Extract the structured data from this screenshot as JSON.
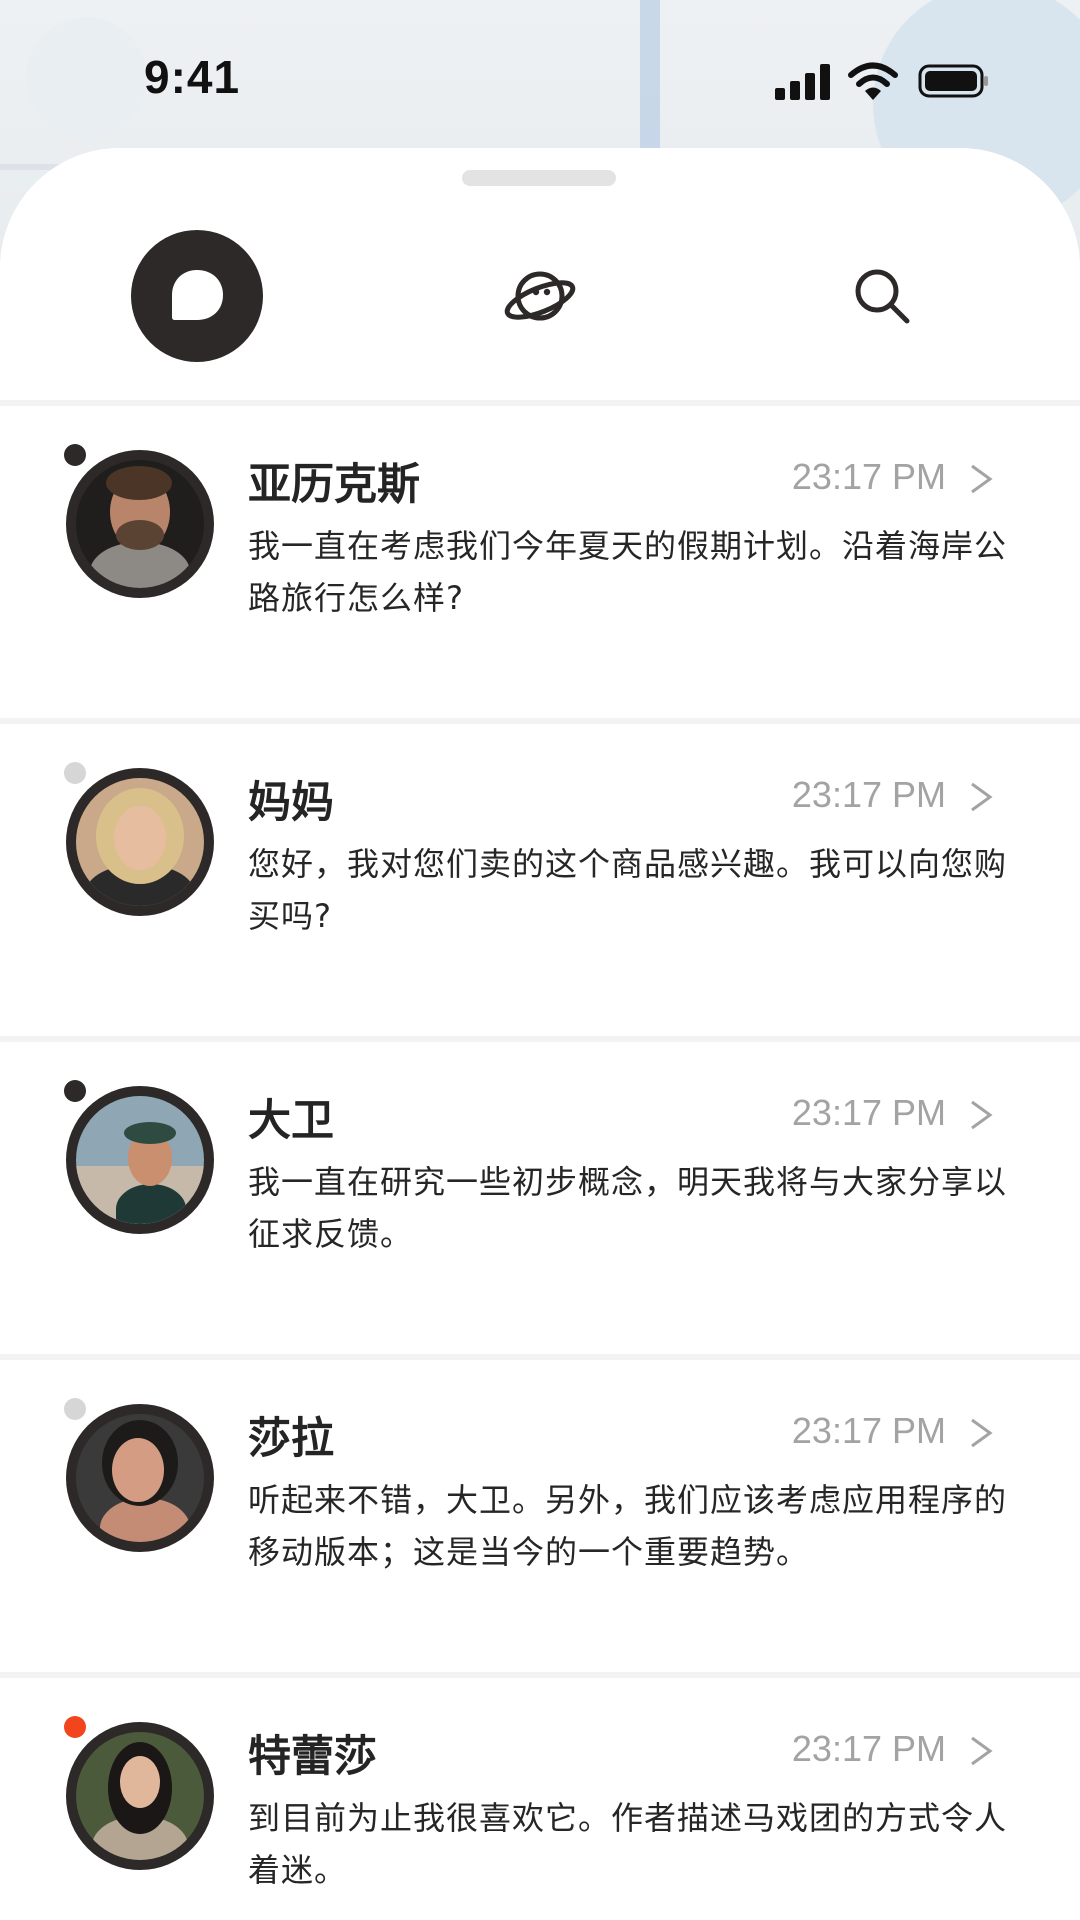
{
  "status_bar": {
    "time": "9:41"
  },
  "theme": {
    "dark": "#2c2928",
    "online_dot": "#2c2928",
    "offline_dot": "#d6d6d6",
    "alert_dot": "#f2451e",
    "time_color": "#a3a3a3"
  },
  "tabs": [
    {
      "name": "chats",
      "icon": "chat-bubble-icon",
      "active": true
    },
    {
      "name": "explore",
      "icon": "planet-icon",
      "active": false
    },
    {
      "name": "search",
      "icon": "search-icon",
      "active": false
    }
  ],
  "chats": [
    {
      "name": "亚历克斯",
      "time": "23:17 PM",
      "preview": "我一直在考虑我们今年夏天的假期计划。沿着海岸公路旅行怎么样?",
      "status": "online"
    },
    {
      "name": "妈妈",
      "time": "23:17 PM",
      "preview": "您好，我对您们卖的这个商品感兴趣。我可以向您购买吗?",
      "status": "offline"
    },
    {
      "name": "大卫",
      "time": "23:17 PM",
      "preview": "我一直在研究一些初步概念，明天我将与大家分享以征求反馈。",
      "status": "online"
    },
    {
      "name": "莎拉",
      "time": "23:17 PM",
      "preview": "听起来不错，大卫。另外，我们应该考虑应用程序的移动版本；这是当今的一个重要趋势。",
      "status": "offline"
    },
    {
      "name": "特蕾莎",
      "time": "23:17 PM",
      "preview": "到目前为止我很喜欢它。作者描述马戏团的方式令人着迷。",
      "status": "alert"
    }
  ]
}
